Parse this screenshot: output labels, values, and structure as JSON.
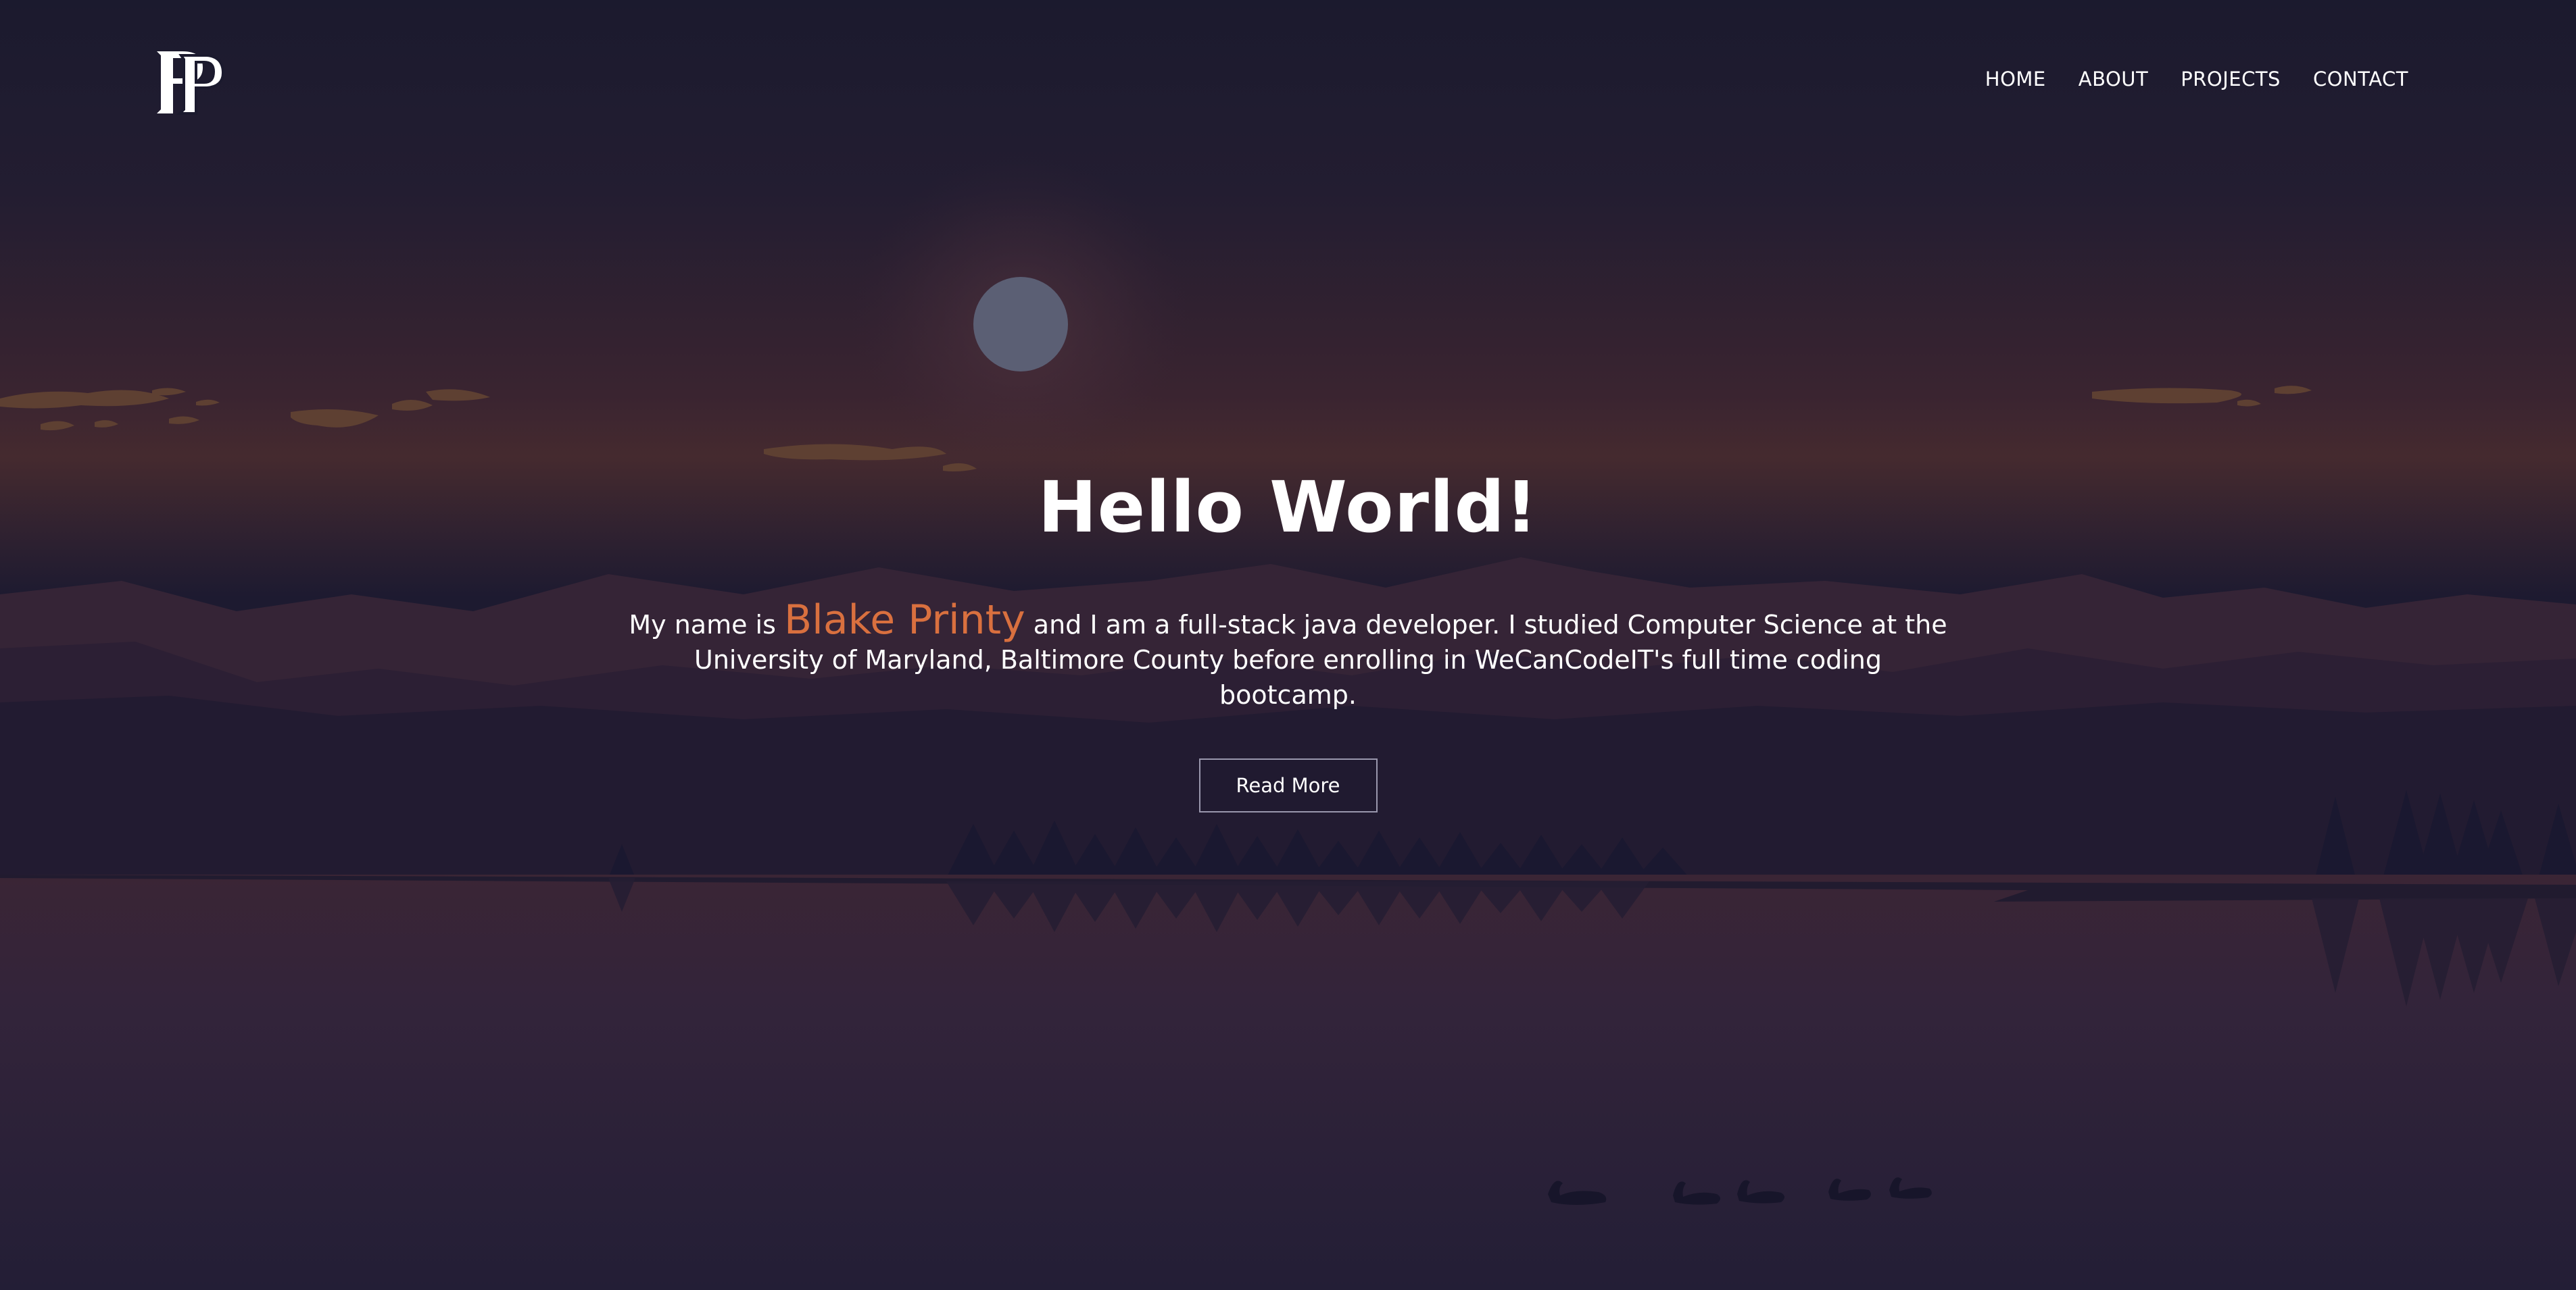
{
  "nav": {
    "logo_alt": "BP",
    "links": [
      "HOME",
      "ABOUT",
      "PROJECTS",
      "CONTACT"
    ]
  },
  "hero": {
    "title": "Hello World!",
    "intro_prefix": "My name is ",
    "name": "Blake Printy",
    "intro_suffix": " and I am a full-stack java developer. I studied Computer Science at the University of Maryland, Baltimore County before enrolling in WeCanCodeIT's full time coding bootcamp.",
    "button_label": "Read More"
  },
  "colors": {
    "accent": "#d9703f",
    "sky_top": "#1b1a2e",
    "sky_horizon": "#3d2630",
    "water": "#2e2335",
    "moon": "#5b5f74"
  }
}
